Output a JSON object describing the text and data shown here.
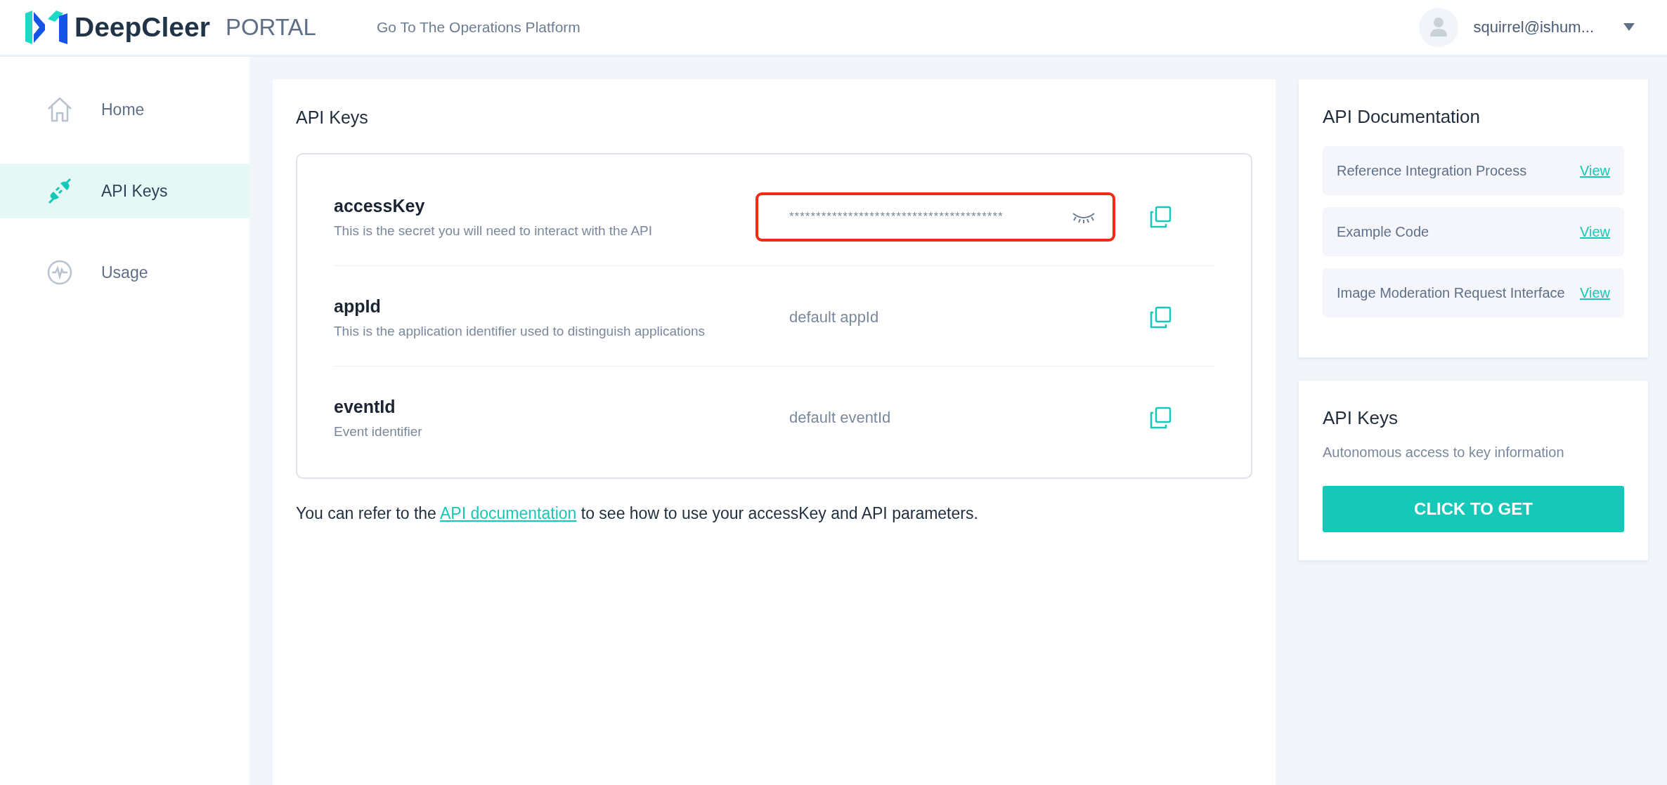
{
  "header": {
    "brand": "DeepCleer",
    "product": "PORTAL",
    "nav_link": "Go To The Operations Platform",
    "user": "squirrel@ishum..."
  },
  "sidebar": {
    "items": [
      {
        "label": "Home",
        "kind": "home",
        "selected": false
      },
      {
        "label": "API Keys",
        "kind": "plug",
        "selected": true
      },
      {
        "label": "Usage",
        "kind": "pulse",
        "selected": false
      }
    ]
  },
  "main": {
    "title": "API Keys",
    "keys": [
      {
        "name": "accessKey",
        "description": "This is the secret you will need to interact with the API",
        "kind": "secret",
        "value": "****************************************",
        "highlighted": true
      },
      {
        "name": "appId",
        "description": "This is the application identifier used to distinguish applications",
        "kind": "text",
        "value": "default appId",
        "highlighted": false
      },
      {
        "name": "eventId",
        "description": "Event identifier",
        "kind": "text",
        "value": "default eventId",
        "highlighted": false
      }
    ],
    "note": {
      "before": "You can refer to the",
      "link": "API documentation",
      "after": "to see how to use your accessKey and API parameters."
    }
  },
  "documentation": {
    "title": "API Documentation",
    "items": [
      {
        "label": "Reference Integration Process",
        "link": "View"
      },
      {
        "label": "Example Code",
        "link": "View"
      },
      {
        "label": "Image Moderation Request Interface",
        "link": "View"
      }
    ]
  },
  "keys_panel": {
    "title": "API Keys",
    "subtitle": "Autonomous access to key information",
    "button": "CLICK TO GET"
  }
}
